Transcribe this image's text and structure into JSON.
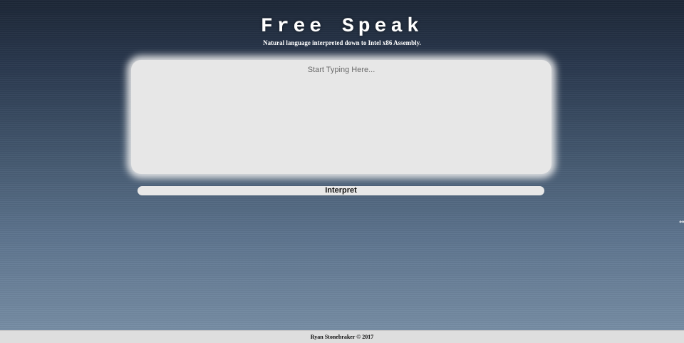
{
  "header": {
    "title": "Free Speak",
    "subtitle": "Natural language interpreted down to Intel x86 Assembly."
  },
  "editor": {
    "placeholder": "Start Typing Here...",
    "value": ""
  },
  "actions": {
    "interpret_label": "Interpret"
  },
  "footer": {
    "text": "Ryan Stonebraker © 2017"
  },
  "icons": {
    "cursor": "resize-cursor-icon"
  }
}
